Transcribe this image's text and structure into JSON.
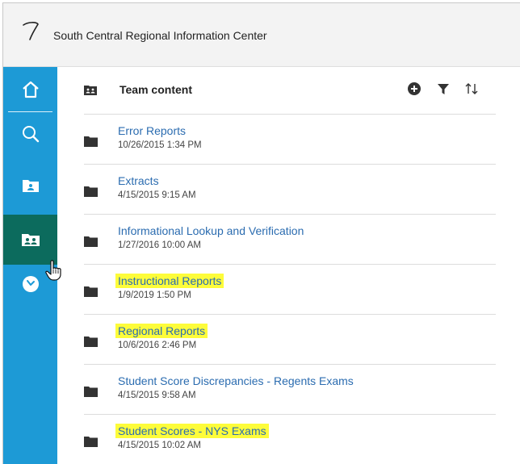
{
  "app": {
    "title": "South Central Regional Information Center"
  },
  "colors": {
    "sidebar": "#1d9ad6",
    "sidebar_active": "#0c6b5d",
    "link": "#2b6cb0",
    "highlight": "#fdfc3a"
  },
  "sidebar": {
    "items": [
      {
        "name": "home",
        "icon": "home-icon",
        "active": false
      },
      {
        "name": "search",
        "icon": "search-icon",
        "active": false
      },
      {
        "name": "my-content",
        "icon": "my-content-folder-icon",
        "active": false
      },
      {
        "name": "team-content",
        "icon": "team-folder-icon",
        "active": true
      },
      {
        "name": "recent",
        "icon": "clock-icon",
        "active": false
      }
    ]
  },
  "main": {
    "header": {
      "title": "Team content",
      "icon": "team-folder-icon",
      "tools": [
        "add-icon",
        "filter-icon",
        "sort-icon"
      ]
    },
    "folders": [
      {
        "name": "Error Reports",
        "date": "10/26/2015 1:34 PM",
        "highlighted": false
      },
      {
        "name": "Extracts",
        "date": "4/15/2015 9:15 AM",
        "highlighted": false
      },
      {
        "name": "Informational Lookup and Verification",
        "date": "1/27/2016 10:00 AM",
        "highlighted": false
      },
      {
        "name": "Instructional Reports",
        "date": "1/9/2019 1:50 PM",
        "highlighted": true
      },
      {
        "name": "Regional Reports",
        "date": "10/6/2016 2:46 PM",
        "highlighted": true
      },
      {
        "name": "Student Score Discrepancies - Regents Exams",
        "date": "4/15/2015 9:58 AM",
        "highlighted": false
      },
      {
        "name": "Student Scores - NYS Exams",
        "date": "4/15/2015 10:02 AM",
        "highlighted": true
      }
    ]
  }
}
